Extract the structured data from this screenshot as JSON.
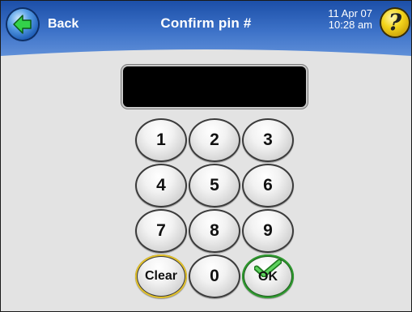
{
  "header": {
    "back_label": "Back",
    "title": "Confirm pin #",
    "date": "11 Apr 07",
    "time": "10:28 am",
    "help_glyph": "?"
  },
  "pin_display": {
    "value": ""
  },
  "keypad": {
    "keys": [
      "1",
      "2",
      "3",
      "4",
      "5",
      "6",
      "7",
      "8",
      "9"
    ],
    "clear_label": "Clear",
    "zero_label": "0",
    "ok_label": "OK"
  },
  "icons": {
    "back": "arrow-left-icon",
    "help": "question-mark-icon",
    "ok": "checkmark-icon"
  },
  "colors": {
    "header_blue": "#3d72c8",
    "back_button": "#1f5fb8",
    "help_button": "#f3d51c",
    "ok_accent": "#2f9a2f",
    "clear_accent": "#e2c12a",
    "background": "#e3e3e3"
  }
}
